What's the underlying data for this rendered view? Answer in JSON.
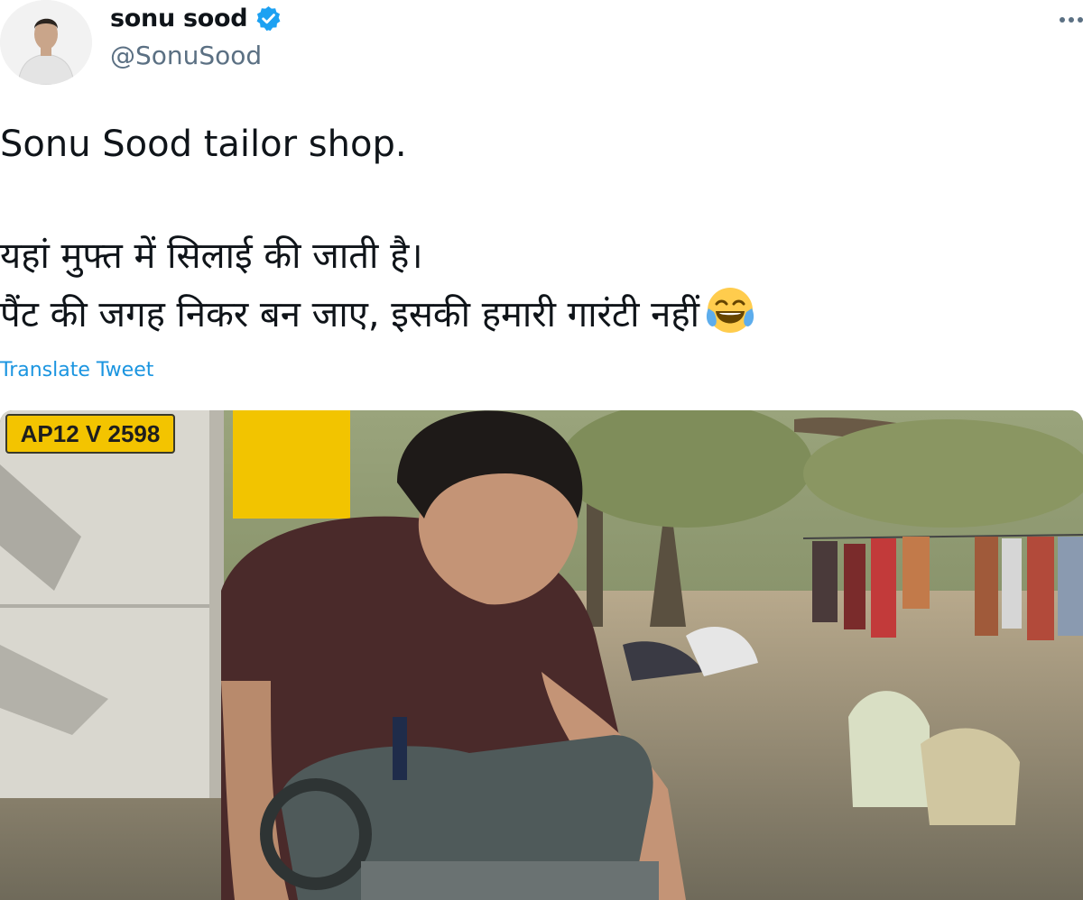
{
  "author": {
    "display_name": "sonu sood",
    "handle": "@SonuSood",
    "verified": true,
    "verified_color": "#1da1f2"
  },
  "menu": {
    "icon": "more-horizontal-icon"
  },
  "tweet": {
    "lines": [
      "Sonu Sood tailor shop.",
      "यहां मुफ्त में सिलाई की जाती है।",
      "पैंट की जगह निकर बन जाए, इसकी हमारी गारंटी नहीं"
    ],
    "emoji": "face-with-tears-of-joy-icon",
    "translate_label": "Translate Tweet",
    "link_color": "#1b95e0"
  },
  "media": {
    "license_plate": "AP12 V 2598"
  }
}
